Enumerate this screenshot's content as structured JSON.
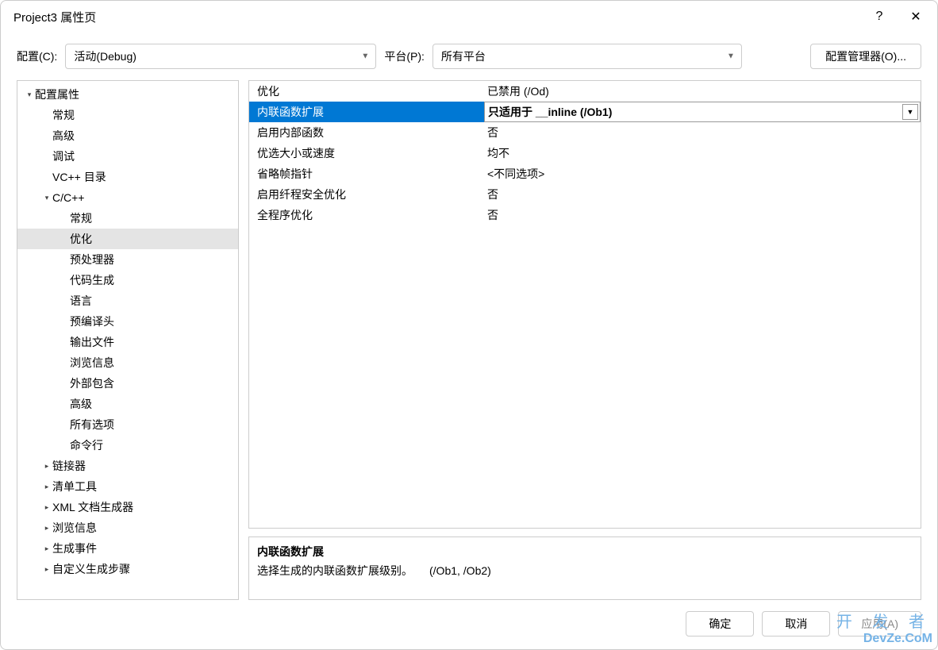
{
  "title": "Project3 属性页",
  "help_icon": "?",
  "close_icon": "✕",
  "config_label": "配置(C):",
  "config_value": "活动(Debug)",
  "platform_label": "平台(P):",
  "platform_value": "所有平台",
  "mgr_button": "配置管理器(O)...",
  "tree": [
    {
      "label": "配置属性",
      "depth": 0,
      "caret": "down"
    },
    {
      "label": "常规",
      "depth": 1,
      "caret": ""
    },
    {
      "label": "高级",
      "depth": 1,
      "caret": ""
    },
    {
      "label": "调试",
      "depth": 1,
      "caret": ""
    },
    {
      "label": "VC++ 目录",
      "depth": 1,
      "caret": ""
    },
    {
      "label": "C/C++",
      "depth": 1,
      "caret": "down"
    },
    {
      "label": "常规",
      "depth": 2,
      "caret": ""
    },
    {
      "label": "优化",
      "depth": 2,
      "caret": "",
      "selected": true
    },
    {
      "label": "预处理器",
      "depth": 2,
      "caret": ""
    },
    {
      "label": "代码生成",
      "depth": 2,
      "caret": ""
    },
    {
      "label": "语言",
      "depth": 2,
      "caret": ""
    },
    {
      "label": "预编译头",
      "depth": 2,
      "caret": ""
    },
    {
      "label": "输出文件",
      "depth": 2,
      "caret": ""
    },
    {
      "label": "浏览信息",
      "depth": 2,
      "caret": ""
    },
    {
      "label": "外部包含",
      "depth": 2,
      "caret": ""
    },
    {
      "label": "高级",
      "depth": 2,
      "caret": ""
    },
    {
      "label": "所有选项",
      "depth": 2,
      "caret": ""
    },
    {
      "label": "命令行",
      "depth": 2,
      "caret": ""
    },
    {
      "label": "链接器",
      "depth": 1,
      "caret": "right"
    },
    {
      "label": "清单工具",
      "depth": 1,
      "caret": "right"
    },
    {
      "label": "XML 文档生成器",
      "depth": 1,
      "caret": "right"
    },
    {
      "label": "浏览信息",
      "depth": 1,
      "caret": "right"
    },
    {
      "label": "生成事件",
      "depth": 1,
      "caret": "right"
    },
    {
      "label": "自定义生成步骤",
      "depth": 1,
      "caret": "right"
    }
  ],
  "grid": [
    {
      "name": "优化",
      "value": "已禁用 (/Od)",
      "selected": false
    },
    {
      "name": "内联函数扩展",
      "value": "只适用于 __inline (/Ob1)",
      "selected": true
    },
    {
      "name": "启用内部函数",
      "value": "否",
      "selected": false
    },
    {
      "name": "优选大小或速度",
      "value": "均不",
      "selected": false
    },
    {
      "name": "省略帧指针",
      "value": "<不同选项>",
      "selected": false
    },
    {
      "name": "启用纤程安全优化",
      "value": "否",
      "selected": false
    },
    {
      "name": "全程序优化",
      "value": "否",
      "selected": false
    }
  ],
  "desc_title": "内联函数扩展",
  "desc_body": "选择生成的内联函数扩展级别。　　(/Ob1, /Ob2)",
  "btn_ok": "确定",
  "btn_cancel": "取消",
  "btn_apply": "应用(A)",
  "watermark1": "开 发 者",
  "watermark2": "DevZe.CoM"
}
